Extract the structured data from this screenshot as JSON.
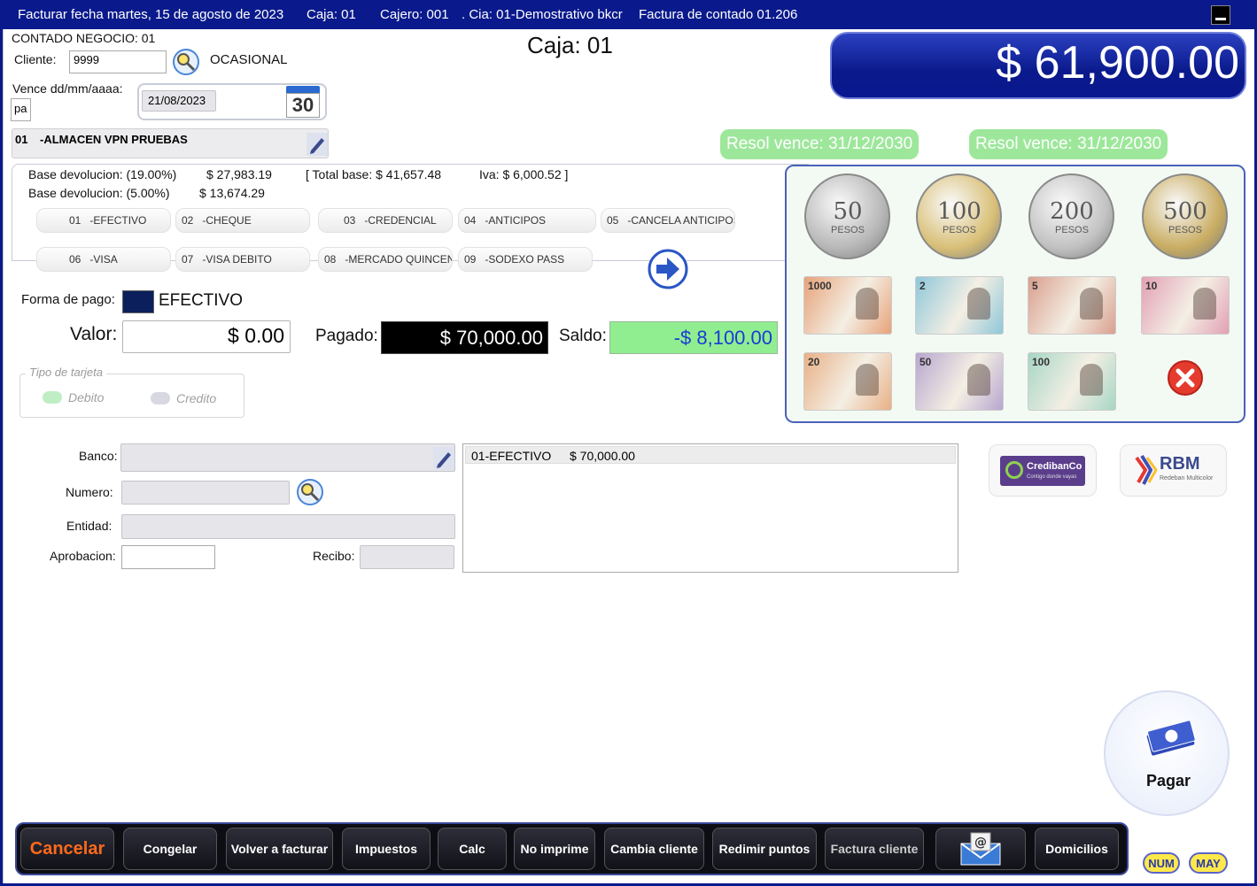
{
  "titlebar": {
    "date": "Facturar fecha martes, 15 de agosto de 2023",
    "caja": "Caja: 01",
    "cajero": "Cajero: 001",
    "cia": ". Cia: 01-Demostrativo bkcr",
    "factura": "Factura de contado  01.206"
  },
  "header": {
    "negocio": "CONTADO NEGOCIO: 01",
    "cliente_label": "Cliente:",
    "cliente_value": "9999",
    "cliente_name": "OCASIONAL",
    "vence_label": "Vence dd/mm/aaaa:",
    "vence_code": "pa",
    "vence_value": "21/08/2023",
    "calendar_day": "30",
    "almacen_code": "01",
    "almacen_name": "-ALMACEN VPN PRUEBAS",
    "caja_title": "Caja: 01",
    "total": "$ 61,900.00",
    "resol1": "Resol vence: 31/12/2030",
    "resol2": "Resol vence: 31/12/2030"
  },
  "base": {
    "line1_label": "Base devolucion: (19.00%)",
    "line1_value": "$ 27,983.19",
    "total_base": "[ Total base: $ 41,657.48",
    "iva": "Iva: $ 6,000.52 ]",
    "line2_label": "Base devolucion: (5.00%)",
    "line2_value": "$ 13,674.29"
  },
  "payment_methods": [
    {
      "code": "01",
      "name": "-EFECTIVO"
    },
    {
      "code": "02",
      "name": "-CHEQUE"
    },
    {
      "code": "03",
      "name": "-CREDENCIAL"
    },
    {
      "code": "04",
      "name": "-ANTICIPOS"
    },
    {
      "code": "05",
      "name": "-CANCELA ANTICIPOS"
    },
    {
      "code": "06",
      "name": "-VISA"
    },
    {
      "code": "07",
      "name": "-VISA DEBITO"
    },
    {
      "code": "08",
      "name": "-MERCADO QUINCENA"
    },
    {
      "code": "09",
      "name": "-SODEXO PASS"
    }
  ],
  "pago": {
    "forma_label": "Forma de pago:",
    "forma_value": "EFECTIVO",
    "valor_label": "Valor:",
    "valor_value": "$ 0.00",
    "pagado_label": "Pagado:",
    "pagado_value": "$ 70,000.00",
    "saldo_label": "Saldo:",
    "saldo_value": "-$ 8,100.00",
    "tarjeta_label": "Tipo de tarjeta",
    "debito": "Debito",
    "credito": "Credito"
  },
  "coins": [
    {
      "value": "50",
      "unit": "PESOS",
      "color": "#b8b8b8"
    },
    {
      "value": "100",
      "unit": "PESOS",
      "color": "#d9c078"
    },
    {
      "value": "200",
      "unit": "PESOS",
      "color": "#c2c2c2"
    },
    {
      "value": "500",
      "unit": "PESOS",
      "color": "#c9ad63"
    }
  ],
  "bills": [
    {
      "value": "1000",
      "color": "#e7a27a"
    },
    {
      "value": "2",
      "color": "#8fc7d9"
    },
    {
      "value": "5",
      "color": "#d99f8e"
    },
    {
      "value": "10",
      "color": "#e2a0b5"
    },
    {
      "value": "20",
      "color": "#e8b086"
    },
    {
      "value": "50",
      "color": "#b7a6cf"
    },
    {
      "value": "100",
      "color": "#a6d6c5"
    }
  ],
  "detalle": {
    "banco_label": "Banco:",
    "numero_label": "Numero:",
    "entidad_label": "Entidad:",
    "aprobacion_label": "Aprobacion:",
    "recibo_label": "Recibo:",
    "list": [
      {
        "method": "01-EFECTIVO",
        "amount": "$ 70,000.00"
      }
    ]
  },
  "brands": {
    "credibanco": "CredibanCo",
    "credibanco_tag": "Contigo donde vayas",
    "rbm": "RBM",
    "rbm_tag": "Redeban Multicolor"
  },
  "pagar": "Pagar",
  "bottom_buttons": {
    "cancelar": "Cancelar",
    "congelar": "Congelar",
    "volver": "Volver a facturar",
    "impuestos": "Impuestos",
    "calc": "Calc",
    "no_imprime": "No imprime",
    "cambia_cliente": "Cambia cliente",
    "redimir": "Redimir puntos",
    "factura_cliente": "Factura cliente",
    "domicilios": "Domicilios"
  },
  "status": {
    "num": "NUM",
    "may": "MAY"
  },
  "colors": {
    "frame": "#0a1a8c",
    "saldo_bg": "#90ee90",
    "saldo_text": "#1a3bd6",
    "resol_bg": "#9de79b",
    "cancel_text": "#ff6a1a"
  }
}
